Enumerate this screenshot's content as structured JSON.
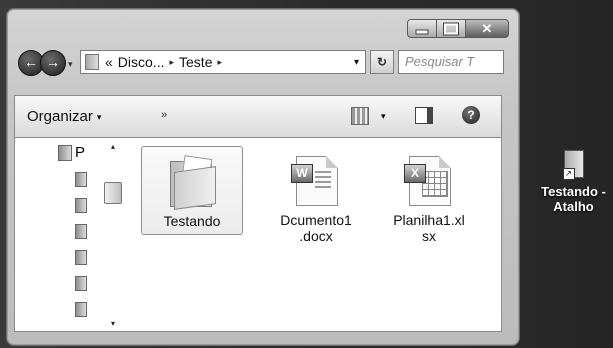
{
  "window": {
    "controls": {
      "minimize_icon": "minimize-icon",
      "maximize_icon": "maximize-icon",
      "close_glyph": "✕"
    }
  },
  "navigation": {
    "back_glyph": "←",
    "forward_glyph": "→",
    "address": {
      "prefix": "«",
      "crumbs": [
        "Disco...",
        "Teste"
      ],
      "separator": "▸",
      "dropdown": "▾"
    },
    "refresh_glyph": "↻",
    "search_placeholder": "Pesquisar T"
  },
  "toolbar": {
    "organize_label": "Organizar",
    "organize_caret": "▾",
    "more_label": "»",
    "views_caret": "▾",
    "help_glyph": "?"
  },
  "tree": {
    "top_label": "P",
    "scroll_up": "▴",
    "scroll_down": "▾"
  },
  "files": [
    {
      "name": "Testando",
      "type": "folder",
      "selected": true
    },
    {
      "name": "Dcumento1\n.docx",
      "type": "word",
      "badge": "W"
    },
    {
      "name": "Planilha1.xl\nsx",
      "type": "excel",
      "badge": "X"
    }
  ],
  "desktop": {
    "shortcut_label": "Testando -\nAtalho",
    "shortcut_arrow": "↗"
  }
}
